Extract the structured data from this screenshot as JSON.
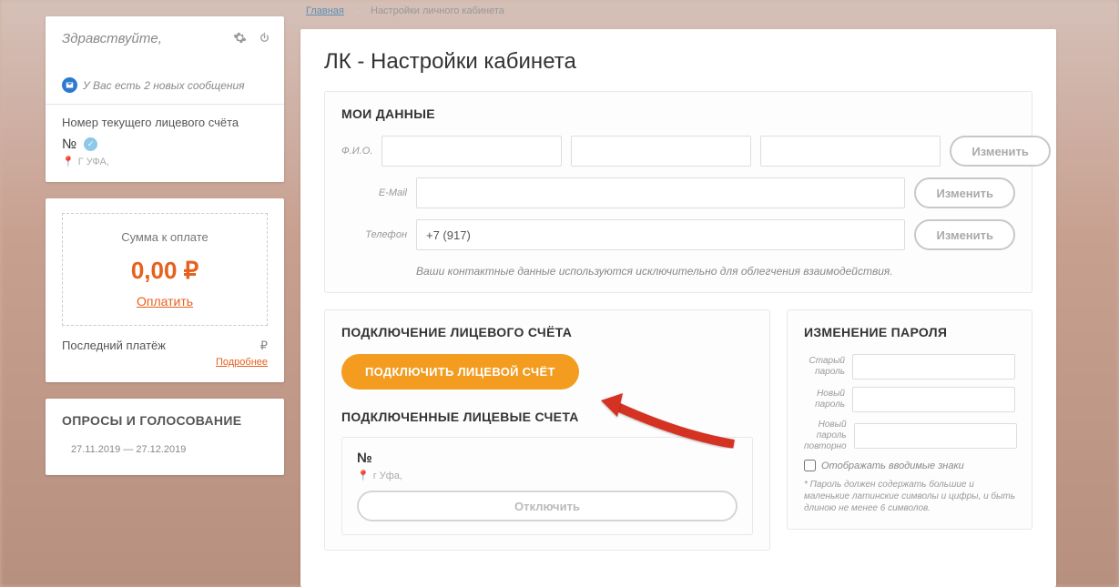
{
  "breadcrumbs": {
    "home": "Главная",
    "current": "Настройки личного кабинета"
  },
  "page": {
    "title": "ЛК - Настройки кабинета"
  },
  "sidebar": {
    "greeting": "Здравствуйте,",
    "messages": "У Вас есть 2 новых сообщения",
    "account_label": "Номер текущего лицевого счёта",
    "account_no": "№",
    "address": "Г УФА,",
    "pay_label": "Сумма к оплате",
    "pay_amount": "0,00 ₽",
    "pay_link": "Оплатить",
    "last_payment_label": "Последний платёж",
    "last_payment_curr": "₽",
    "more": "Подробнее",
    "polls_title": "ОПРОСЫ И ГОЛОСОВАНИЕ",
    "polls_date": "27.11.2019 — 27.12.2019"
  },
  "mydata": {
    "heading": "МОИ ДАННЫЕ",
    "fio_label": "Ф.И.О.",
    "email_label": "E-Mail",
    "phone_label": "Телефон",
    "phone_value": "+7 (917)",
    "change_btn": "Изменить",
    "note": "Ваши контактные данные используются исключительно для облегчения взаимодействия."
  },
  "connect": {
    "heading": "ПОДКЛЮЧЕНИЕ ЛИЦЕВОГО СЧЁТА",
    "button": "ПОДКЛЮЧИТЬ ЛИЦЕВОЙ СЧЁТ",
    "list_heading": "ПОДКЛЮЧЕННЫЕ ЛИЦЕВЫЕ СЧЕТА",
    "acc_no": "№",
    "acc_addr": "г Уфа,",
    "disconnect": "Отключить"
  },
  "password": {
    "heading": "ИЗМЕНЕНИЕ ПАРОЛЯ",
    "old": "Старый пароль",
    "new": "Новый пароль",
    "repeat": "Новый пароль повторно",
    "show": "Отображать вводимые знаки",
    "note": "* Пароль должен содержать большие и маленькие латинские символы и цифры, и быть длиною не менее 6 символов."
  }
}
